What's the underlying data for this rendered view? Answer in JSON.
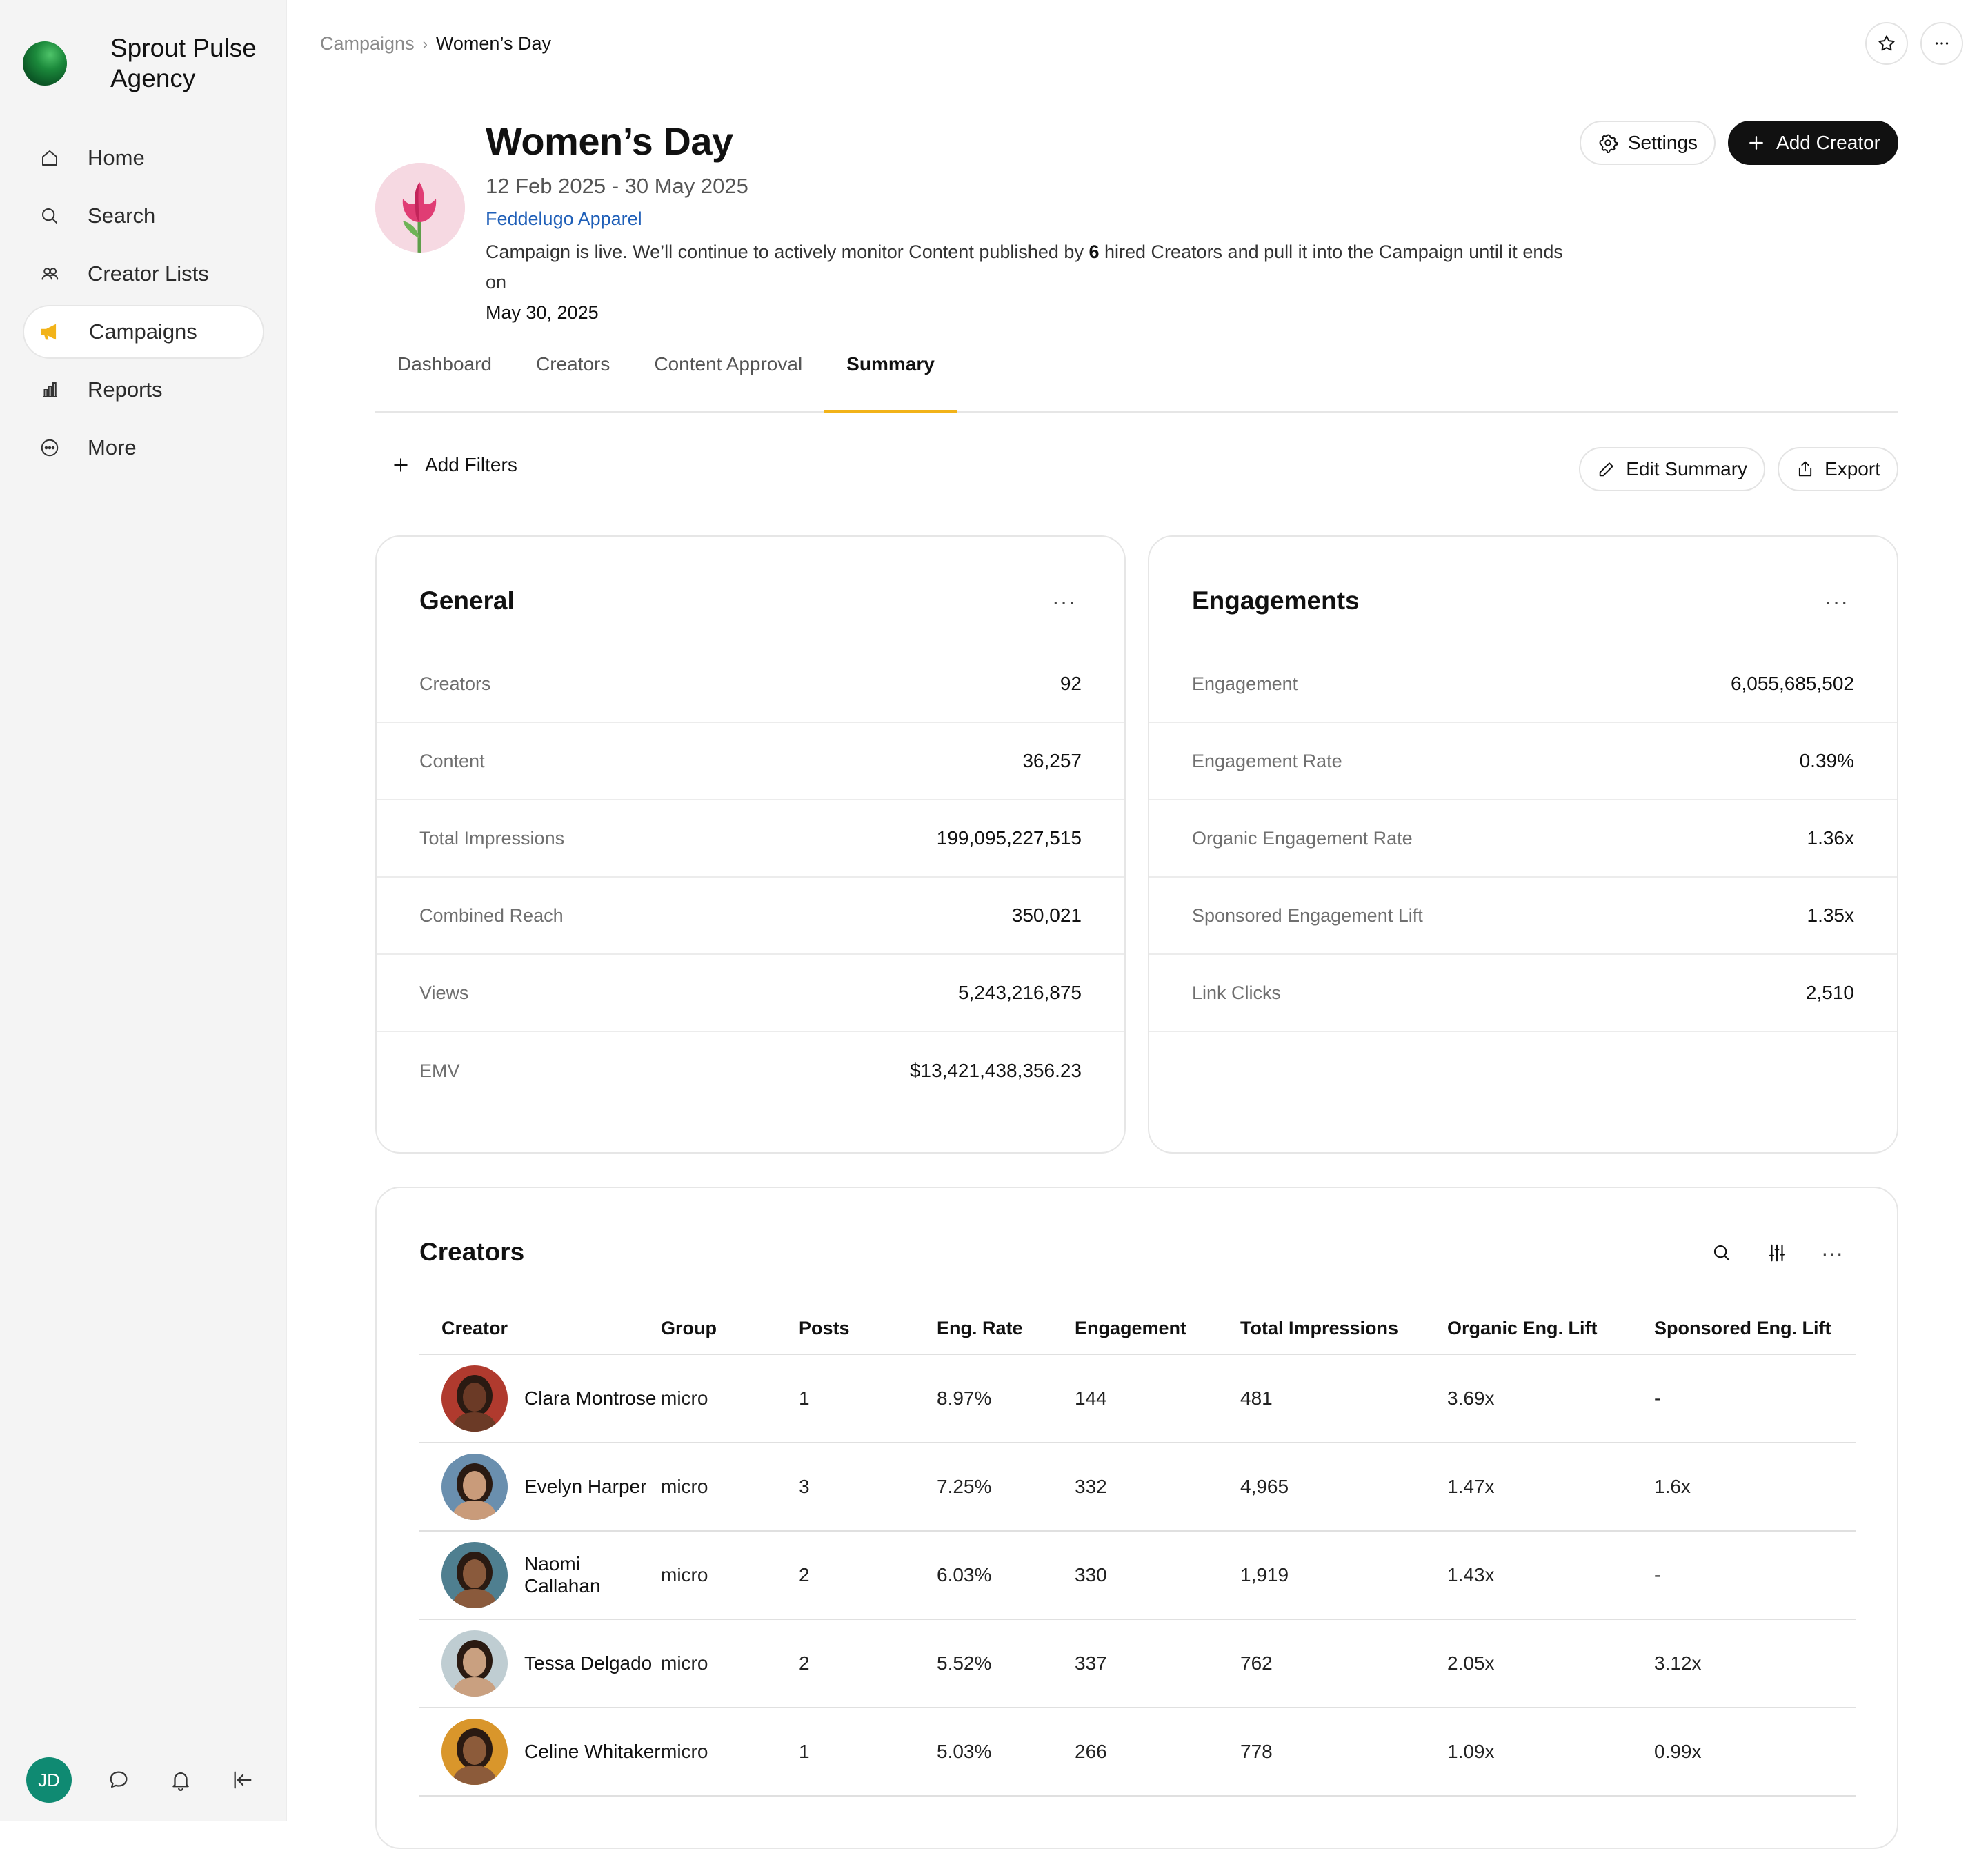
{
  "brand": {
    "name": "Sprout Pulse Agency"
  },
  "nav": {
    "items": [
      {
        "label": "Home",
        "icon": "home-icon"
      },
      {
        "label": "Search",
        "icon": "search-icon"
      },
      {
        "label": "Creator Lists",
        "icon": "users-icon"
      },
      {
        "label": "Campaigns",
        "icon": "megaphone-icon",
        "active": true
      },
      {
        "label": "Reports",
        "icon": "bar-chart-icon"
      },
      {
        "label": "More",
        "icon": "more-circle-icon"
      }
    ]
  },
  "user": {
    "initials": "JD"
  },
  "breadcrumb": {
    "parent": "Campaigns",
    "separator": "›",
    "current": "Women’s Day"
  },
  "campaign": {
    "title": "Women’s Day",
    "dates": "12 Feb 2025 - 30 May 2025",
    "brand": "Feddelugo Apparel",
    "desc_prefix": "Campaign is live. We’ll continue to actively monitor Content published by ",
    "hired_count": "6",
    "desc_suffix": " hired Creators and pull it into the Campaign until it ends on",
    "end_date": "May 30, 2025"
  },
  "header_buttons": {
    "settings": "Settings",
    "add_creator": "Add Creator"
  },
  "tabs": [
    {
      "label": "Dashboard"
    },
    {
      "label": "Creators"
    },
    {
      "label": "Content Approval"
    },
    {
      "label": "Summary",
      "active": true
    }
  ],
  "filters": {
    "add_label": "Add Filters",
    "edit_summary": "Edit Summary",
    "export": "Export"
  },
  "general": {
    "title": "General",
    "more": "···",
    "rows": [
      {
        "label": "Creators",
        "value": "92"
      },
      {
        "label": "Content",
        "value": "36,257"
      },
      {
        "label": "Total Impressions",
        "value": "199,095,227,515"
      },
      {
        "label": "Combined Reach",
        "value": "350,021"
      },
      {
        "label": "Views",
        "value": "5,243,216,875"
      },
      {
        "label": "EMV",
        "value": "$13,421,438,356.23"
      }
    ]
  },
  "engagements": {
    "title": "Engagements",
    "more": "···",
    "rows": [
      {
        "label": "Engagement",
        "value": "6,055,685,502"
      },
      {
        "label": "Engagement Rate",
        "value": "0.39%"
      },
      {
        "label": "Organic Engagement Rate",
        "value": "1.36x"
      },
      {
        "label": "Sponsored Engagement Lift",
        "value": "1.35x"
      },
      {
        "label": "Link Clicks",
        "value": "2,510"
      }
    ]
  },
  "creators_table": {
    "title": "Creators",
    "more": "···",
    "columns": [
      "Creator",
      "Group",
      "Posts",
      "Eng. Rate",
      "Engagement",
      "Total Impressions",
      "Organic Eng. Lift",
      "Sponsored Eng. Lift"
    ],
    "rows": [
      {
        "name": "Clara Montrose",
        "group": "micro",
        "posts": "1",
        "eng_rate": "8.97%",
        "engagement": "144",
        "impressions": "481",
        "organic": "3.69x",
        "sponsored": "-",
        "avatar_bg": "#b03a2e",
        "skin": "#6b3a26"
      },
      {
        "name": "Evelyn Harper",
        "group": "micro",
        "posts": "3",
        "eng_rate": "7.25%",
        "engagement": "332",
        "impressions": "4,965",
        "organic": "1.47x",
        "sponsored": "1.6x",
        "avatar_bg": "#6a8fae",
        "skin": "#c99b7a"
      },
      {
        "name": "Naomi Callahan",
        "group": "micro",
        "posts": "2",
        "eng_rate": "6.03%",
        "engagement": "330",
        "impressions": "1,919",
        "organic": "1.43x",
        "sponsored": "-",
        "avatar_bg": "#4f7f90",
        "skin": "#8a5a3c"
      },
      {
        "name": "Tessa Delgado",
        "group": "micro",
        "posts": "2",
        "eng_rate": "5.52%",
        "engagement": "337",
        "impressions": "762",
        "organic": "2.05x",
        "sponsored": "3.12x",
        "avatar_bg": "#bfcdd2",
        "skin": "#c9a080"
      },
      {
        "name": "Celine Whitaker",
        "group": "micro",
        "posts": "1",
        "eng_rate": "5.03%",
        "engagement": "266",
        "impressions": "778",
        "organic": "1.09x",
        "sponsored": "0.99x",
        "avatar_bg": "#d9962b",
        "skin": "#8c5b3a"
      }
    ]
  },
  "colors": {
    "accent": "#f2b319",
    "brand_link": "#1f5fb8",
    "avatar_jd": "#0f8a72"
  }
}
